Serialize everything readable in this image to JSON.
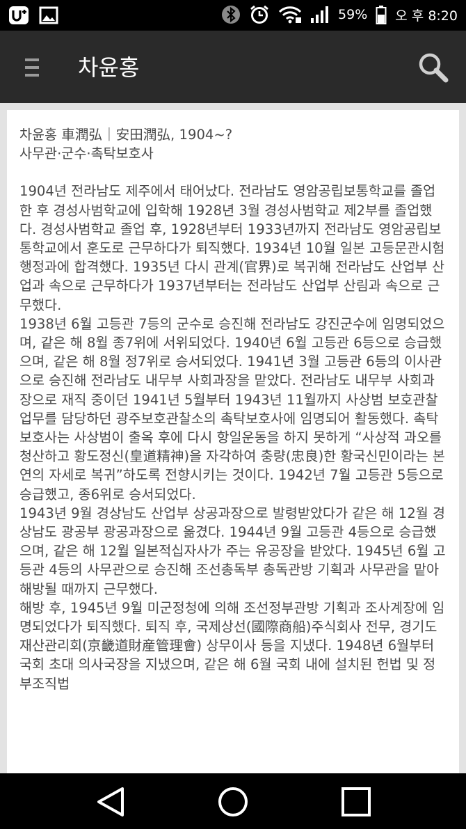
{
  "status_bar": {
    "left_icons": [
      "u-plus-icon",
      "gallery-icon"
    ],
    "right_icons": [
      "bluetooth-icon",
      "alarm-icon",
      "wifi-icon",
      "signal-icon"
    ],
    "battery": "59%",
    "time": "오 후 8:20"
  },
  "app_bar": {
    "title": "차윤홍",
    "menu_icon": "menu-icon",
    "search_icon": "search-icon"
  },
  "article": {
    "header_line1": "차윤홍 車潤弘｜安田潤弘, 1904~?",
    "header_line2": "사무관·군수·촉탁보호사",
    "paragraphs": [
      "1904년 전라남도 제주에서 태어났다. 전라남도 영암공립보통학교를 졸업한 후 경성사범학교에 입학해 1928년 3월 경성사범학교 제2부를 졸업했다. 경성사범학교 졸업 후, 1928년부터 1933년까지 전라남도 영암공립보통학교에서 훈도로 근무하다가 퇴직했다. 1934년 10월 일본 고등문관시험 행정과에 합격했다. 1935년 다시 관계(官界)로 복귀해 전라남도 산업부 산업과 속으로 근무하다가 1937년부터는 전라남도 산업부 산림과 속으로 근무했다.",
      "1938년 6월 고등관 7등의 군수로 승진해 전라남도 강진군수에 임명되었으며, 같은 해 8월 종7위에 서위되었다. 1940년 6월 고등관 6등으로 승급했으며, 같은 해 8월 정7위로 승서되었다. 1941년 3월 고등관 6등의 이사관으로 승진해 전라남도 내무부 사회과장을 맡았다. 전라남도 내무부 사회과장으로 재직 중이던 1941년 5월부터 1943년 11월까지 사상범 보호관찰 업무를 담당하던 광주보호관찰소의 촉탁보호사에 임명되어 활동했다. 촉탁보호사는 사상범이 출옥 후에 다시 항일운동을 하지 못하게 “사상적 과오를 청산하고 황도정신(皇道精神)을 자각하여 충량(忠良)한 황국신민이라는 본연의 자세로 복귀”하도록 전향시키는 것이다. 1942년 7월 고등관 5등으로 승급했고, 종6위로 승서되었다.",
      "1943년 9월 경상남도 산업부 상공과장으로 발령받았다가 같은 해 12월 경상남도 광공부 광공과장으로 옮겼다. 1944년 9월 고등관 4등으로 승급했으며, 같은 해 12월 일본적십자사가 주는 유공장을 받았다. 1945년 6월 고등관 4등의 사무관으로 승진해 조선총독부 총독관방 기획과 사무관을 맡아 해방될 때까지 근무했다.",
      "해방 후, 1945년 9월 미군정청에 의해 조선정부관방 기획과 조사계장에 임명되었다가 퇴직했다. 퇴직 후, 국제상선(國際商船)주식회사 전무, 경기도 재산관리회(京畿道財産管理會) 상무이사 등을 지냈다. 1948년 6월부터 국회 초대 의사국장을 지냈으며, 같은 해 6월 국회 내에 설치된 헌법 및 정부조직법"
    ]
  },
  "nav_bar": {
    "back_icon": "back-triangle-icon",
    "home_icon": "home-circle-icon",
    "recents_icon": "recents-square-icon"
  }
}
